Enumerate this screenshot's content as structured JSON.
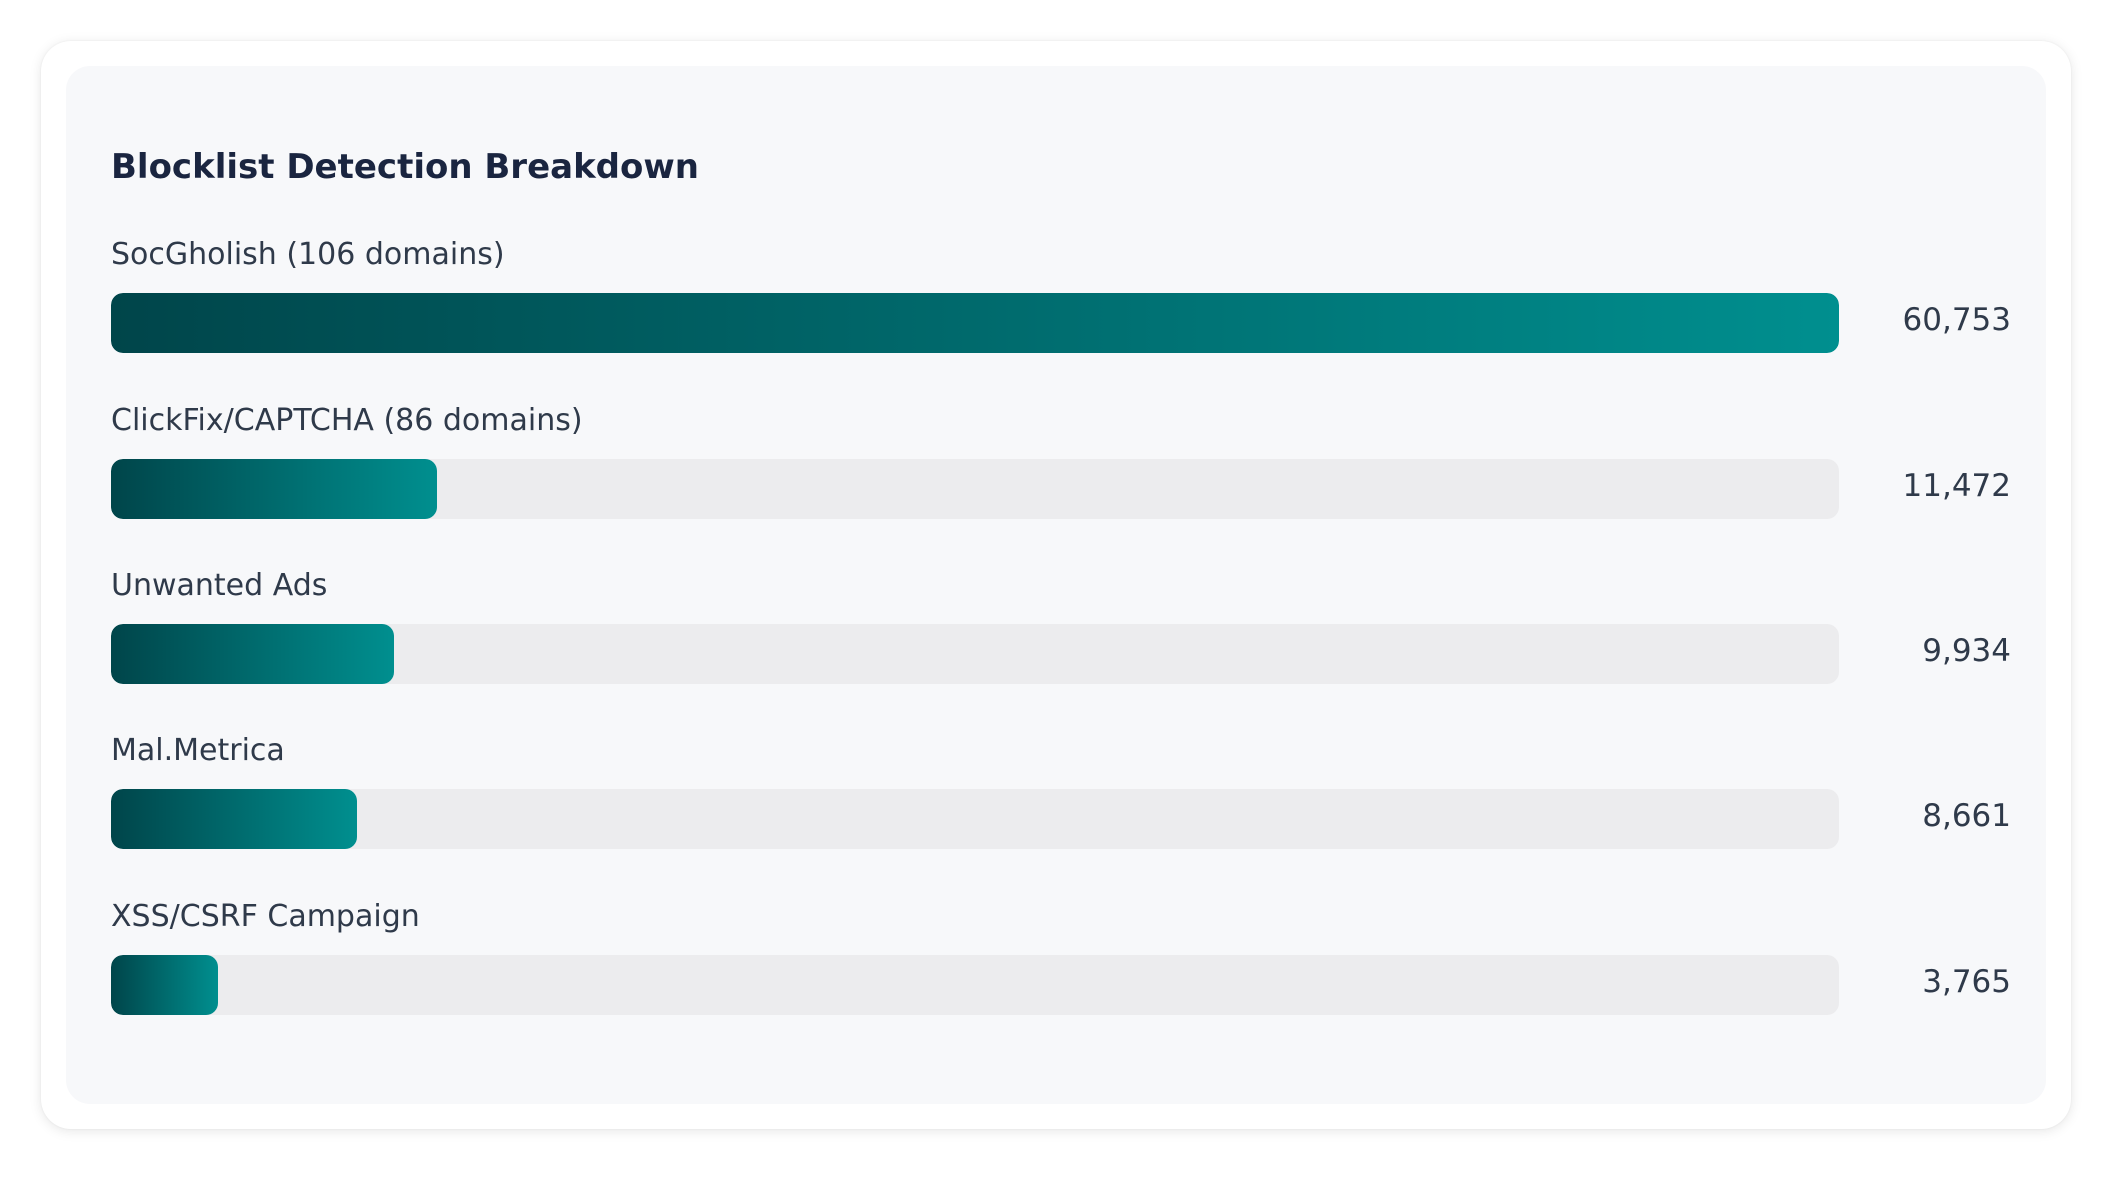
{
  "chart_data": {
    "type": "bar",
    "orientation": "horizontal",
    "title": "Blocklist Detection Breakdown",
    "categories": [
      "SocGholish (106 domains)",
      "ClickFix/CAPTCHA (86 domains)",
      "Unwanted Ads",
      "Mal.Metrica",
      "XSS/CSRF Campaign"
    ],
    "values": [
      60753,
      11472,
      9934,
      8661,
      3765
    ],
    "value_labels": [
      "60,753",
      "11,472",
      "9,934",
      "8,661",
      "3,765"
    ],
    "xlim": [
      0,
      60753
    ],
    "grid": false,
    "colors": {
      "bar_start": "#00454a",
      "bar_end": "#008f8f",
      "track": "#ececee"
    }
  }
}
